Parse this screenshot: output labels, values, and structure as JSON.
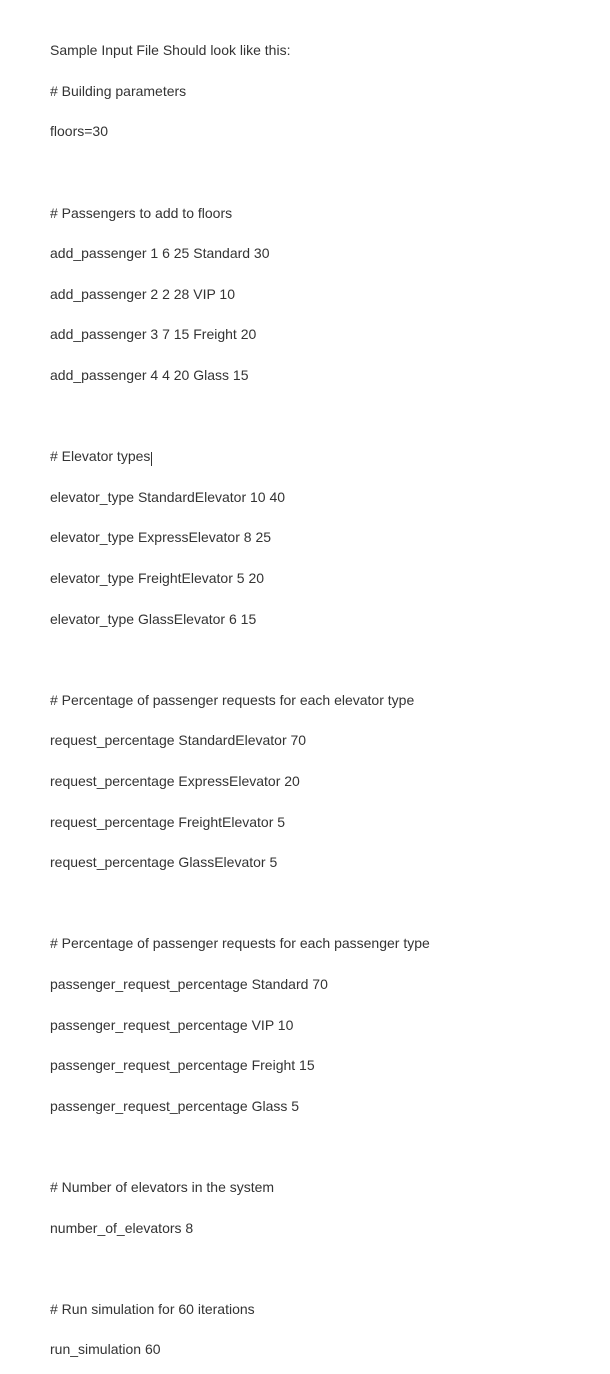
{
  "intro": "Sample Input File Should look like this:",
  "sections": {
    "building": {
      "comment": "# Building parameters",
      "floors": "floors=30"
    },
    "passengers": {
      "comment": "# Passengers to add to floors",
      "lines": [
        "add_passenger 1 6 25 Standard 30",
        "add_passenger 2 2 28 VIP 10",
        "add_passenger 3 7 15 Freight 20",
        "add_passenger 4 4 20 Glass 15"
      ]
    },
    "elevator_types": {
      "comment": "# Elevator types",
      "lines": [
        "elevator_type StandardElevator 10 40",
        "elevator_type ExpressElevator 8 25",
        "elevator_type FreightElevator 5 20",
        "elevator_type GlassElevator 6 15"
      ]
    },
    "request_percentage": {
      "comment": "# Percentage of passenger requests for each elevator type",
      "lines": [
        "request_percentage StandardElevator 70",
        "request_percentage ExpressElevator 20",
        "request_percentage FreightElevator 5",
        "request_percentage GlassElevator 5"
      ]
    },
    "passenger_request_percentage": {
      "comment": "# Percentage of passenger requests for each passenger type",
      "lines": [
        "passenger_request_percentage Standard 70",
        "passenger_request_percentage VIP 10",
        "passenger_request_percentage Freight 15",
        "passenger_request_percentage Glass 5"
      ]
    },
    "num_elevators": {
      "comment": "# Number of elevators in the system",
      "line": "number_of_elevators 8"
    },
    "run_sim": {
      "comment": "# Run simulation for 60 iterations",
      "line": "run_simulation 60"
    }
  }
}
